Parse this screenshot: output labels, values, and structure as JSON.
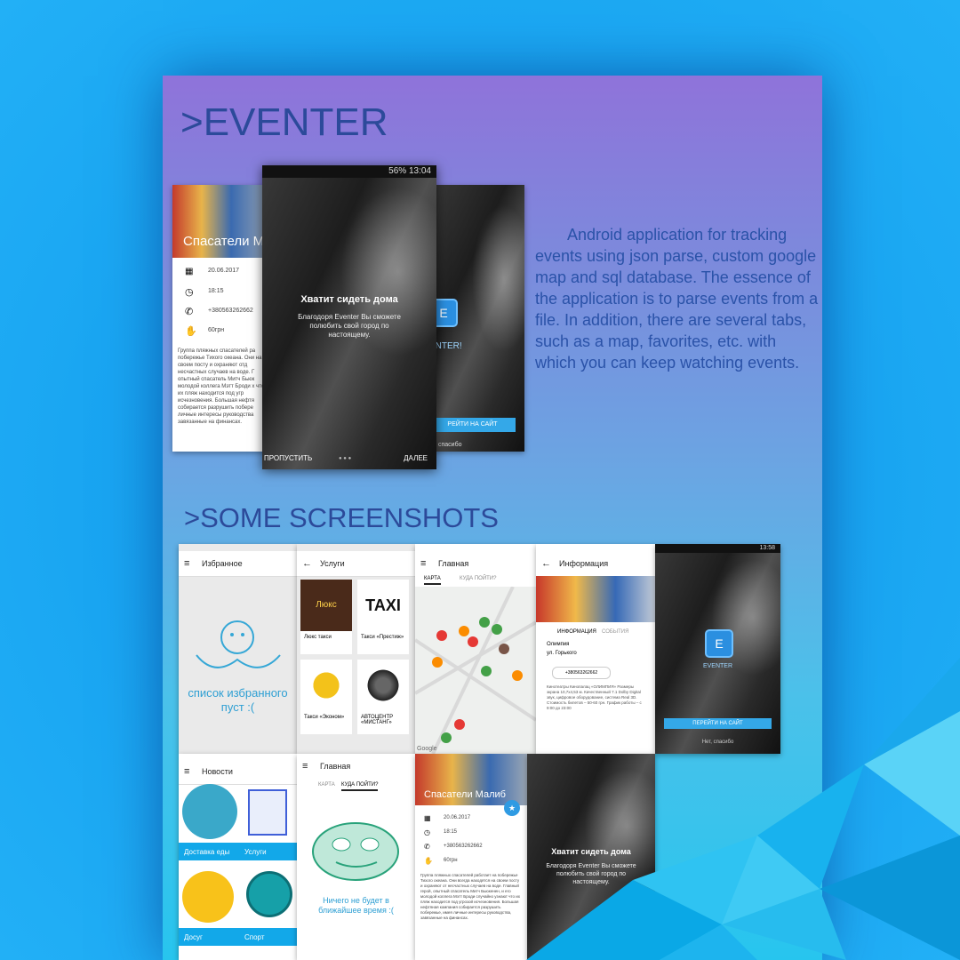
{
  "title": ">EVENTER",
  "screens_title": ">SOME SCREENSHOTS",
  "description": "Android application for tracking events using json parse, custom google map and sql database. The essence of the application is to parse events from a file. In addition, there are several tabs, such as a map, favorites, etc. with which you can keep watching events.",
  "colors": {
    "accent": "#2c4a9a",
    "blue_button": "#34a8e8",
    "background": "#1aa3f0"
  },
  "hero": {
    "left": {
      "title": "Спасатели М",
      "date": "20.06.2017",
      "time": "18:15",
      "phone": "+380563262662",
      "price": "60грн",
      "text": "Группа пляжных спасателей ра побережье Тихого океана. Они на своем посту и охраняют отд несчастных случаев на воде. Г опытный спасатель Митч Бьюк молодой коллега Мэтт Броди х что их пляж находится под угр исчезновения. Большая нефтя собирается разрушить побере личные интересы руководства завязанные на финансах."
    },
    "center": {
      "status": "56% 13:04",
      "heading": "Хватит сидеть дома",
      "body": "Благодоря Eventer Вы сможете полюбить свой город по настоящему.",
      "skip": "ПРОПУСТИТЬ",
      "next": "ДАЛЕЕ"
    },
    "right": {
      "icon_letter": "E",
      "app_label": "ENTER!",
      "button": "РЕЙТИ НА САЙТ",
      "thanks": "ет, спасибо"
    }
  },
  "shots": {
    "favorites": {
      "title": "Избранное",
      "empty": "список избранного пуст :("
    },
    "services": {
      "title": "Услуги",
      "items": [
        "Люкс такси",
        "Такси «Престиж»",
        "Такси «Эконом»",
        "АВТОЦЕНТР «МИСТАНГ»"
      ],
      "sign1": "Люкс",
      "sign2": "TAXI"
    },
    "map": {
      "title": "Главная",
      "tab1": "КАРТА",
      "tab2": "КУДА ПОЙТИ?",
      "google": "Google"
    },
    "info": {
      "title": "Информация",
      "tab1": "ИНФОРМАЦИЯ",
      "tab2": "СОБЫТИЯ",
      "place": "Олимпия",
      "street": "ул. Горького",
      "phone": "+380563262662",
      "body": "Кинотеатры Кинопалац «ОЛИМПИЯ» Размеры экрана 10,7x4,53 м. Качественный 7.1 Dolby Digital звук, цифровое оборудование, система Real 3D. Стоимость билетов – 50-60 грн. График работы – с 9:00 до 23:00"
    },
    "splash": {
      "time": "13:58",
      "icon_letter": "E",
      "app_label": "EVENTER",
      "button": "ПЕРЕЙТИ НА САЙТ",
      "thanks": "Нет, спасибо"
    },
    "news": {
      "title": "Новости",
      "tiles": [
        "Доставка еды",
        "Услуги",
        "Досуг",
        "Спорт"
      ]
    },
    "main2": {
      "title": "Главная",
      "tab1": "КАРТА",
      "tab2": "КУДА ПОЙТИ?",
      "empty": "Ничего не будет в ближайшее время :("
    },
    "detail": {
      "title": "Спасатели Малиб",
      "date": "20.06.2017",
      "time": "18:15",
      "phone": "+380563262662",
      "price": "60грн",
      "text": "Группа пляжных спасателей работает на побережье Тихого океана. Они всегда находятся на своем посту и охраняют от несчастных случаев на воде. Главный герой, опытный спасатель Митч Бьюкенен, и его молодой коллега Мэтт Броди случайно узнают что их пляж находится под угрозой исчезновения. Большая нефтяная компания собирается разрушить побережье, имея личные интересы руководства, завязанные на финансах."
    },
    "onboard": {
      "heading": "Хватит сидеть дома",
      "body": "Благодоря Eventer Вы сможете полюбить свой город по настоящему."
    }
  }
}
